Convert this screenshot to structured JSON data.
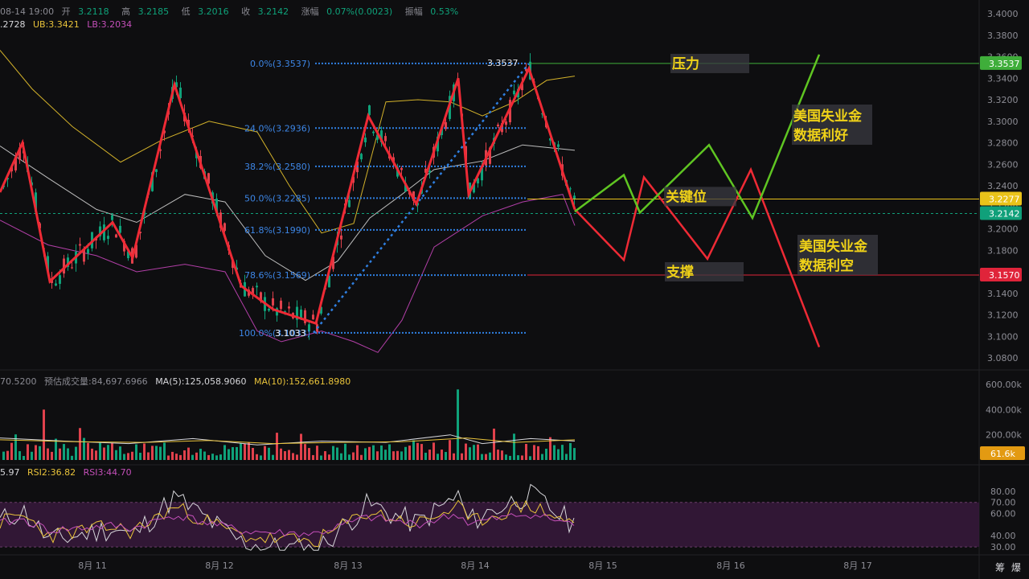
{
  "header": {
    "ohlc": {
      "date": "08-14 19:00",
      "open_label": "开",
      "open": "3.2118",
      "high_label": "高",
      "high": "3.2185",
      "low_label": "低",
      "low": "3.2016",
      "close_label": "收",
      "close": "3.2142",
      "change_label": "涨幅",
      "change": "0.07%(0.0023)",
      "amp_label": "振幅",
      "amp": "0.53%"
    },
    "boll": {
      "mid": ".2728",
      "ub": "UB:3.3421",
      "lb": "LB:3.2034"
    },
    "volume": {
      "vol": "70.5200",
      "est": "预估成交量:84,697.6966",
      "ma5": "MA(5):125,058.9060",
      "ma10": "MA(10):152,661.8980"
    },
    "rsi": {
      "rsi1": "5.97",
      "rsi2": "RSI2:36.82",
      "rsi3": "RSI3:44.70"
    }
  },
  "price_axis": {
    "ticks": [
      "3.4000",
      "3.3800",
      "3.3600",
      "3.3400",
      "3.3200",
      "3.3000",
      "3.2800",
      "3.2600",
      "3.2400",
      "3.2200",
      "3.2000",
      "3.1800",
      "3.1600",
      "3.1400",
      "3.1200",
      "3.1000",
      "3.0800"
    ],
    "markers": [
      {
        "label": "3.3537",
        "color": "#3fae3a"
      },
      {
        "label": "3.2277",
        "color": "#e9c31a"
      },
      {
        "label": "3.2142",
        "color": "#10a07a"
      },
      {
        "label": "3.1570",
        "color": "#e0243a"
      }
    ]
  },
  "volume_axis": {
    "ticks": [
      "600.00k",
      "400.00k",
      "200.00k"
    ],
    "marker": "61.6k",
    "marker_color": "#e39a12"
  },
  "rsi_axis": {
    "ticks": [
      "80.00",
      "70.00",
      "60.00",
      "40.00",
      "30.00"
    ]
  },
  "date_axis": {
    "ticks": [
      "8月 11",
      "8月 12",
      "8月 13",
      "8月 14",
      "8月 15",
      "8月 16",
      "8月 17"
    ]
  },
  "fib_levels": [
    {
      "label": "0.0%(3.3537)",
      "value": 3.3537
    },
    {
      "label": "24.0%(3.2936)",
      "value": 3.2936
    },
    {
      "label": "38.2%(3.2580)",
      "value": 3.258
    },
    {
      "label": "50.0%(3.2285)",
      "value": 3.2285
    },
    {
      "label": "61.8%(3.1990)",
      "value": 3.199
    },
    {
      "label": "78.6%(3.1569)",
      "value": 3.1569
    },
    {
      "label": "100.0%(3.1033)",
      "value": 3.1033
    }
  ],
  "fib_extremes": {
    "high": "3.3537",
    "low": "3.1033"
  },
  "annotations": {
    "resistance": "压力",
    "key_level": "关键位",
    "support": "支撑",
    "bullish_line1": "美国失业金",
    "bullish_line2": "数据利好",
    "bearish_line1": "美国失业金",
    "bearish_line2": "数据利空"
  },
  "bottom_right": {
    "a": "筹",
    "b": "爆"
  },
  "colors": {
    "up": "#0fa27a",
    "down": "#e0414c",
    "zigzag": "#ee2a35",
    "bull": "#5fc522",
    "fib": "#2f7fe0",
    "boll_ub": "#d2b12a",
    "boll_mid": "#bdbdbd",
    "boll_lb": "#b23fa7"
  }
}
